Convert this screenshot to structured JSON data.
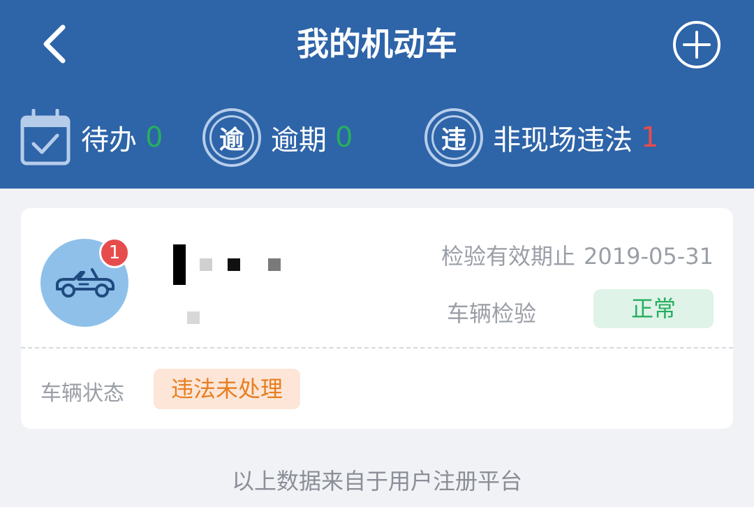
{
  "header": {
    "title": "我的机动车",
    "back_icon": "chevron-left-icon",
    "add_icon": "plus-circle-icon",
    "background": "#2e64a8"
  },
  "stats": {
    "pending": {
      "label": "待办",
      "count": "0",
      "icon": "calendar-check-icon",
      "count_color": "#27ae60"
    },
    "overdue": {
      "label": "逾期",
      "count": "0",
      "icon_text": "逾",
      "count_color": "#27ae60"
    },
    "violation": {
      "label": "非现场违法",
      "count": "1",
      "icon_text": "违",
      "count_color": "#e74c4c"
    }
  },
  "vehicle": {
    "avatar_icon": "convertible-car-icon",
    "badge_count": "1",
    "inspection_label": "检验有效期止",
    "inspection_date": "2019-05-31",
    "check_label": "车辆检验",
    "check_status": "正常",
    "state_label": "车辆状态",
    "state_value": "违法未处理"
  },
  "footer": {
    "note": "以上数据来自于用户注册平台"
  }
}
